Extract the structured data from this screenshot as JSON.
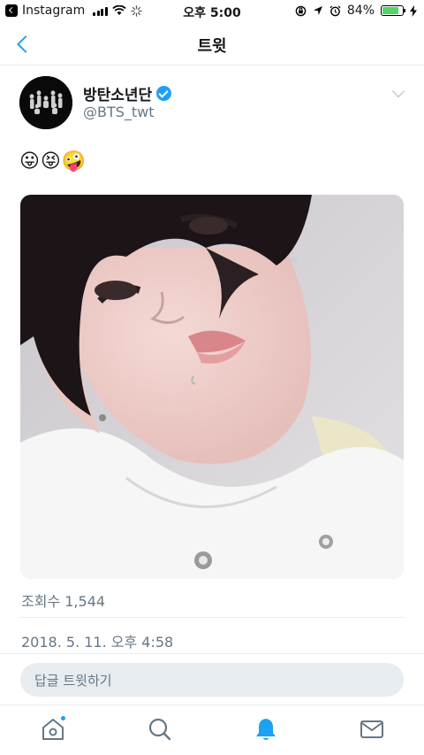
{
  "status_bar": {
    "back_app": "Instagram",
    "time": "오후 5:00",
    "battery_percent": "84%",
    "battery_level": 0.84
  },
  "nav": {
    "title": "트윗"
  },
  "tweet": {
    "author_name": "방탄소년단",
    "author_handle": "@BTS_twt",
    "text": "😛😝🤪",
    "views": "조회수 1,544",
    "timestamp": "2018. 5. 11. 오후 4:58"
  },
  "reply": {
    "placeholder": "답글 트윗하기"
  },
  "tab_bar": {
    "items": [
      "home-icon",
      "search-icon",
      "notifications-icon",
      "messages-icon"
    ],
    "active": "notifications-icon"
  },
  "colors": {
    "accent": "#1da1f2",
    "muted_text": "#657786",
    "divider": "#e6ecf0",
    "battery": "#4cd964"
  }
}
